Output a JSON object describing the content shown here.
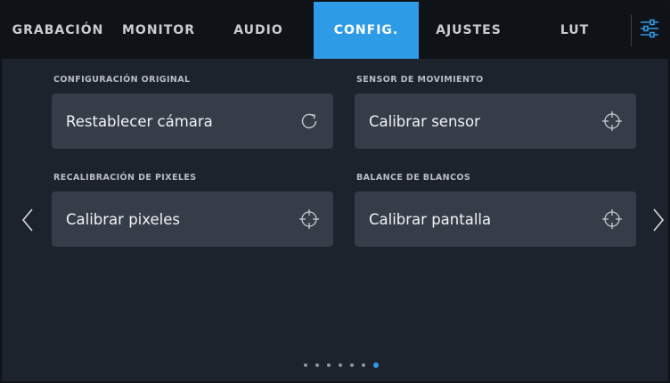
{
  "tabs": [
    {
      "label": "GRABACIÓN",
      "active": false
    },
    {
      "label": "MONITOR",
      "active": false
    },
    {
      "label": "AUDIO",
      "active": false
    },
    {
      "label": "CONFIG.",
      "active": true
    },
    {
      "label": "AJUSTES",
      "active": false
    },
    {
      "label": "LUT",
      "active": false
    }
  ],
  "menu_icon": "sliders-icon",
  "sections": [
    {
      "label": "CONFIGURACIÓN ORIGINAL",
      "button": "Restablecer cámara",
      "icon": "reset-icon"
    },
    {
      "label": "SENSOR DE MOVIMIENTO",
      "button": "Calibrar sensor",
      "icon": "crosshair-icon"
    },
    {
      "label": "RECALIBRACIÓN DE PIXELES",
      "button": "Calibrar pixeles",
      "icon": "crosshair-icon"
    },
    {
      "label": "BALANCE DE BLANCOS",
      "button": "Calibrar pantalla",
      "icon": "crosshair-icon"
    }
  ],
  "pagination": {
    "total": 7,
    "current": 7
  },
  "colors": {
    "accent": "#2e9be6",
    "background": "#1d232c",
    "tabbar": "#0f1217",
    "card": "#353d49"
  }
}
